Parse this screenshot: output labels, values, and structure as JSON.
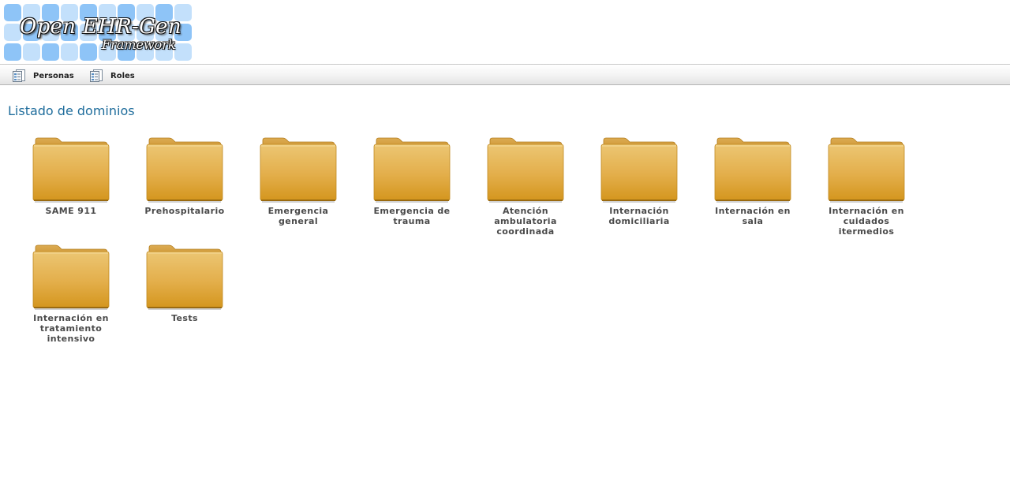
{
  "app": {
    "logo_title": "Open EHR-Gen",
    "logo_subtitle": "Framework",
    "logo_colors": {
      "dark": "#8ec4f7",
      "light": "#c3e0fb"
    }
  },
  "menu": {
    "items": [
      {
        "label": "Personas",
        "icon": "document-list-icon"
      },
      {
        "label": "Roles",
        "icon": "document-list-icon"
      }
    ]
  },
  "main": {
    "title": "Listado de dominios",
    "folder_colors": {
      "top": "#e9c06c",
      "bottom": "#d99a1e",
      "tab": "#d9a13e",
      "edge": "#b07a16"
    },
    "domains": [
      {
        "label": "SAME 911"
      },
      {
        "label": "Prehospitalario"
      },
      {
        "label": "Emergencia general"
      },
      {
        "label": "Emergencia de trauma"
      },
      {
        "label": "Atención ambulatoria coordinada"
      },
      {
        "label": "Internación domiciliaria"
      },
      {
        "label": "Internación en sala"
      },
      {
        "label": "Internación en cuidados itermedios"
      },
      {
        "label": "Internación en tratamiento intensivo"
      },
      {
        "label": "Tests"
      }
    ]
  }
}
